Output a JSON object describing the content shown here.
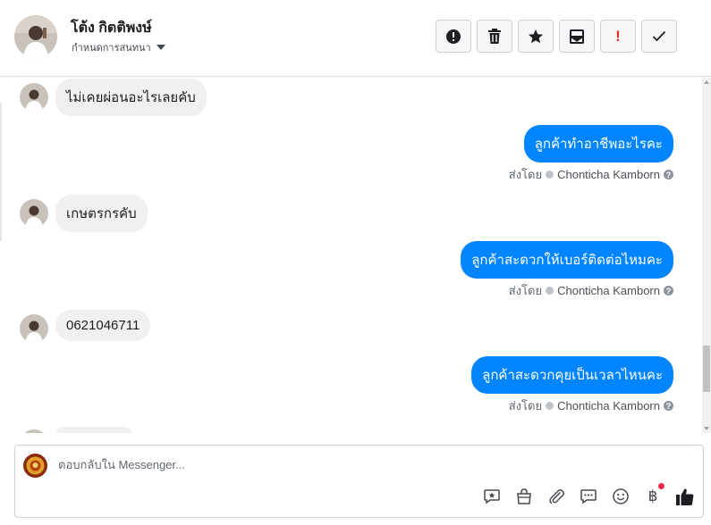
{
  "header": {
    "customer_name": "โต้ง กิตติพงษ์",
    "assign_label": "กำหนดการสนทนา"
  },
  "actions": [
    {
      "icon": "alert-circle-icon"
    },
    {
      "icon": "trash-icon"
    },
    {
      "icon": "star-icon"
    },
    {
      "icon": "mark-unread-icon"
    },
    {
      "icon": "exclamation-icon",
      "label": "!"
    },
    {
      "icon": "checkmark-icon"
    }
  ],
  "thread": {
    "messages": [
      {
        "direction": "in",
        "text": "ไม่เคยผ่อนอะไรเลยคับ"
      },
      {
        "direction": "out",
        "text": "ลูกค้าทำอาชีพอะไรคะ",
        "sent_by_label": "ส่งโดย",
        "agent": "Chonticha Kamborn"
      },
      {
        "direction": "in",
        "text": "เกษตรกรคับ"
      },
      {
        "direction": "out",
        "text": "ลูกค้าสะดวกให้เบอร์ติดต่อไหมคะ",
        "sent_by_label": "ส่งโดย",
        "agent": "Chonticha Kamborn"
      },
      {
        "direction": "in",
        "text": "0621046711"
      },
      {
        "direction": "out",
        "text": "ลูกค้าสะดวกคุยเป็นเวลาไหนคะ",
        "sent_by_label": "ส่งโดย",
        "agent": "Chonticha Kamborn"
      }
    ]
  },
  "composer": {
    "placeholder": "ตอบกลับใน Messenger...",
    "tools": [
      "saved-reply-icon",
      "shop-bag-icon",
      "attachment-icon",
      "chat-bubble-icon",
      "emoji-icon",
      "payment-baht-icon",
      "thumbs-up-icon"
    ],
    "baht_symbol": "฿",
    "colors": {
      "accent": "#0084ff",
      "like": "#1c1e21",
      "notif": "#f02849"
    }
  },
  "colors": {
    "outgoing_bubble": "#0084ff",
    "incoming_bubble": "#f0f0f0"
  }
}
